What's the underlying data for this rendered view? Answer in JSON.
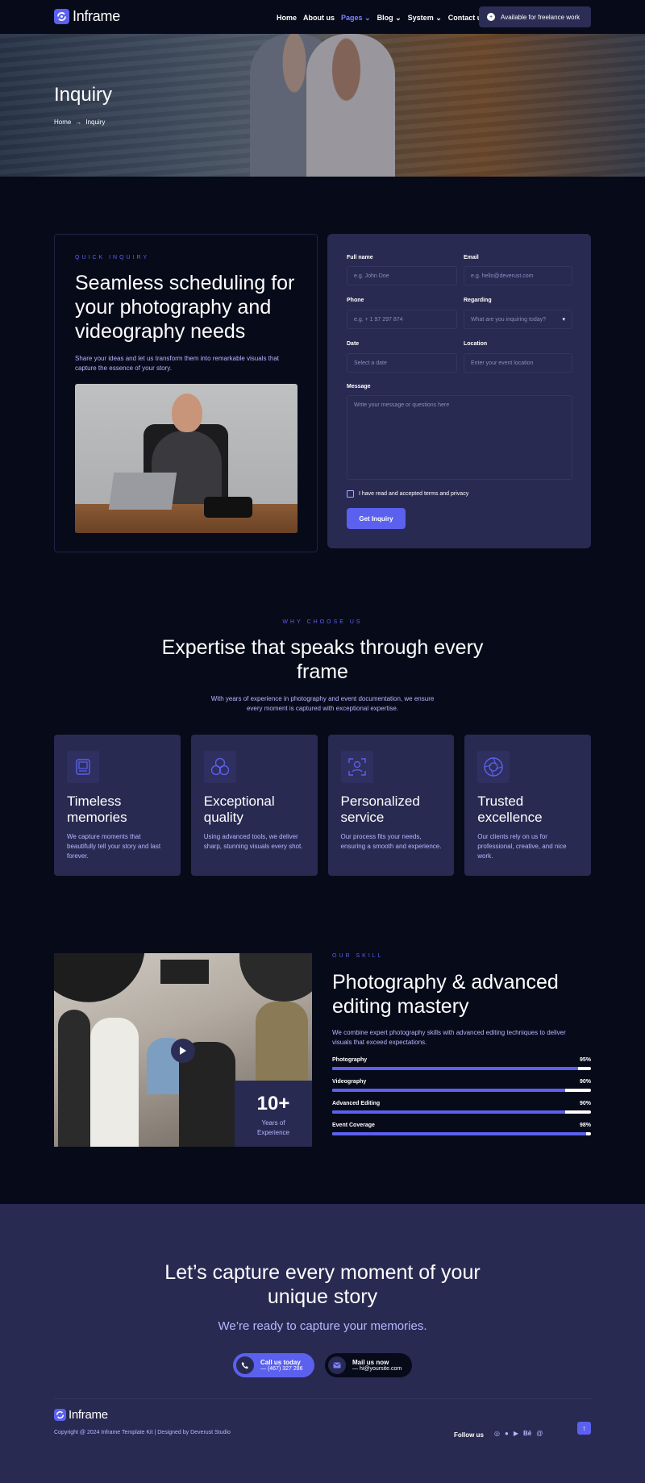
{
  "brand": {
    "name": "Inframe"
  },
  "nav": {
    "items": [
      "Home",
      "About us",
      "Pages",
      "Blog",
      "System",
      "Contact us"
    ],
    "active": "Pages",
    "availability": "Available for freelance work"
  },
  "hero": {
    "title": "Inquiry",
    "breadcrumb": [
      "Home",
      "Inquiry"
    ]
  },
  "inquiry": {
    "eyebrow": "QUICK INQUIRY",
    "title": "Seamless scheduling for your photography and videography needs",
    "description": "Share your ideas and let us transform them into remarkable visuals that capture the essence of your story."
  },
  "form": {
    "full_name": {
      "label": "Full name",
      "placeholder": "e.g. John Doe"
    },
    "email": {
      "label": "Email",
      "placeholder": "e.g. hello@deverust.com"
    },
    "phone": {
      "label": "Phone",
      "placeholder": "e.g. + 1 97 297 874"
    },
    "regarding": {
      "label": "Regarding",
      "value": "What are you inquiring today?"
    },
    "date": {
      "label": "Date",
      "placeholder": "Select a date"
    },
    "location": {
      "label": "Location",
      "placeholder": "Enter your event location"
    },
    "message": {
      "label": "Message",
      "placeholder": "Write your message or questions here"
    },
    "terms": "I have read and accepted terms and privacy",
    "submit": "Get Inquiry"
  },
  "why": {
    "eyebrow": "WHY CHOOSE US",
    "title": "Expertise that speaks through every frame",
    "subtitle": "With years of experience in photography and event documentation, we ensure every moment is captured with exceptional expertise.",
    "cards": [
      {
        "title": "Timeless memories",
        "text": "We capture moments that beautifully tell your story and last forever.",
        "icon": "photo-frame-icon"
      },
      {
        "title": "Exceptional quality",
        "text": "Using advanced tools, we deliver sharp, stunning visuals every shot.",
        "icon": "circles-icon"
      },
      {
        "title": "Personalized service",
        "text": "Our process fits your needs, ensuring a smooth and experience.",
        "icon": "person-focus-icon"
      },
      {
        "title": "Trusted excellence",
        "text": "Our clients rely on us for professional, creative, and nice work.",
        "icon": "aperture-icon"
      }
    ]
  },
  "skill": {
    "eyebrow": "OUR SKILL",
    "title": "Photography & advanced editing mastery",
    "description": "We combine expert photography skills with advanced editing techniques to deliver visuals that exceed expectations.",
    "stat_value": "10+",
    "stat_label": "Years of Experience",
    "bars": [
      {
        "name": "Photography",
        "value": 95,
        "label": "95%"
      },
      {
        "name": "Videography",
        "value": 90,
        "label": "90%"
      },
      {
        "name": "Advanced Editing",
        "value": 90,
        "label": "90%"
      },
      {
        "name": "Event Coverage",
        "value": 98,
        "label": "98%"
      }
    ]
  },
  "cta": {
    "title": "Let’s capture every moment of your unique story",
    "tagline": "We’re ready to capture your memories.",
    "call_title": "Call us today",
    "call_value": "— (467) 327 286",
    "mail_title": "Mail us now",
    "mail_value": "— hi@yoursite.com"
  },
  "footer": {
    "copyright": "Copyright @ 2024 Inframe Template Kit | Designed by Deverust Studio",
    "follow": "Follow us",
    "socials": [
      "instagram-icon",
      "facebook-icon",
      "youtube-icon",
      "behance-icon",
      "threads-icon"
    ]
  },
  "colors": {
    "accent": "#5b61ee",
    "background": "#070a19",
    "panel": "#292a52",
    "muted_text": "#b5b8ff"
  }
}
